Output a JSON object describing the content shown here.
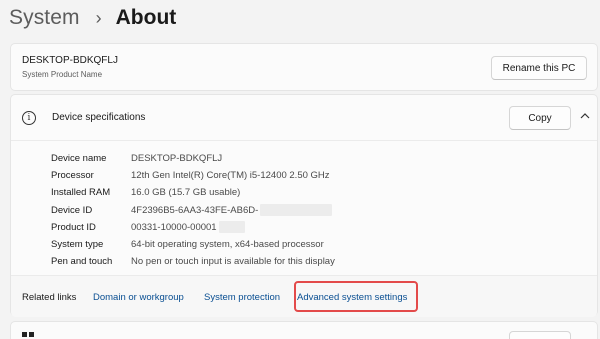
{
  "breadcrumb": {
    "parent": "System",
    "separator": "›",
    "current": "About"
  },
  "pc_card": {
    "name": "DESKTOP-BDKQFLJ",
    "subtitle": "System Product Name",
    "rename_label": "Rename this PC"
  },
  "specs": {
    "title": "Device specifications",
    "copy_label": "Copy",
    "rows": [
      {
        "label": "Device name",
        "value": "DESKTOP-BDKQFLJ"
      },
      {
        "label": "Processor",
        "value": "12th Gen Intel(R) Core(TM) i5-12400   2.50 GHz"
      },
      {
        "label": "Installed RAM",
        "value": "16.0 GB (15.7 GB usable)"
      },
      {
        "label": "Device ID",
        "value": "4F2396B5-6AA3-43FE-AB6D-"
      },
      {
        "label": "Product ID",
        "value": "00331-10000-00001"
      },
      {
        "label": "System type",
        "value": "64-bit operating system, x64-based processor"
      },
      {
        "label": "Pen and touch",
        "value": "No pen or touch input is available for this display"
      }
    ]
  },
  "related_links": {
    "label": "Related links",
    "links": [
      "Domain or workgroup",
      "System protection",
      "Advanced system settings"
    ]
  },
  "colors": {
    "link": "#0a4f92",
    "highlight": "#e34a4a"
  },
  "icons": {
    "info": "info-circle-icon",
    "chevron": "chevron-up-icon",
    "windows": "windows-logo-icon"
  }
}
